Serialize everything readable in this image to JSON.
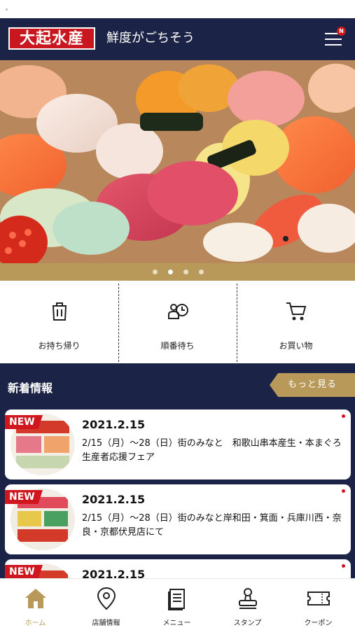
{
  "header": {
    "logo_text": "大起水産",
    "tagline": "鮮度がごちそう",
    "menu_badge": "N"
  },
  "carousel": {
    "slide_count": 4,
    "active_index": 1
  },
  "quick_actions": [
    {
      "label": "お持ち帰り",
      "icon": "takeout-bag-icon"
    },
    {
      "label": "順番待ち",
      "icon": "queue-clock-icon"
    },
    {
      "label": "お買い物",
      "icon": "shopping-cart-icon"
    }
  ],
  "news": {
    "title": "新着情報",
    "more_label": "もっと見る",
    "items": [
      {
        "badge": "NEW",
        "date": "2021.2.15",
        "text": "2/15（月）～28（日）街のみなと　和歌山串本産生・本まぐろ生産者応援フェア"
      },
      {
        "badge": "NEW",
        "date": "2021.2.15",
        "text": "2/15（月）～28（日）街のみなと岸和田・箕面・兵庫川西・奈良・京都伏見店にて"
      },
      {
        "badge": "NEW",
        "date": "2021.2.15",
        "text": ""
      }
    ]
  },
  "tabbar": [
    {
      "label": "ホーム",
      "icon": "home-icon",
      "active": true
    },
    {
      "label": "店舗情報",
      "icon": "location-pin-icon",
      "active": false
    },
    {
      "label": "メニュー",
      "icon": "menu-document-icon",
      "active": false
    },
    {
      "label": "スタンプ",
      "icon": "stamp-icon",
      "active": false
    },
    {
      "label": "クーポン",
      "icon": "coupon-ticket-icon",
      "active": false
    }
  ],
  "colors": {
    "navy": "#1b2446",
    "brand_red": "#c8171f",
    "gold": "#b8995a"
  }
}
